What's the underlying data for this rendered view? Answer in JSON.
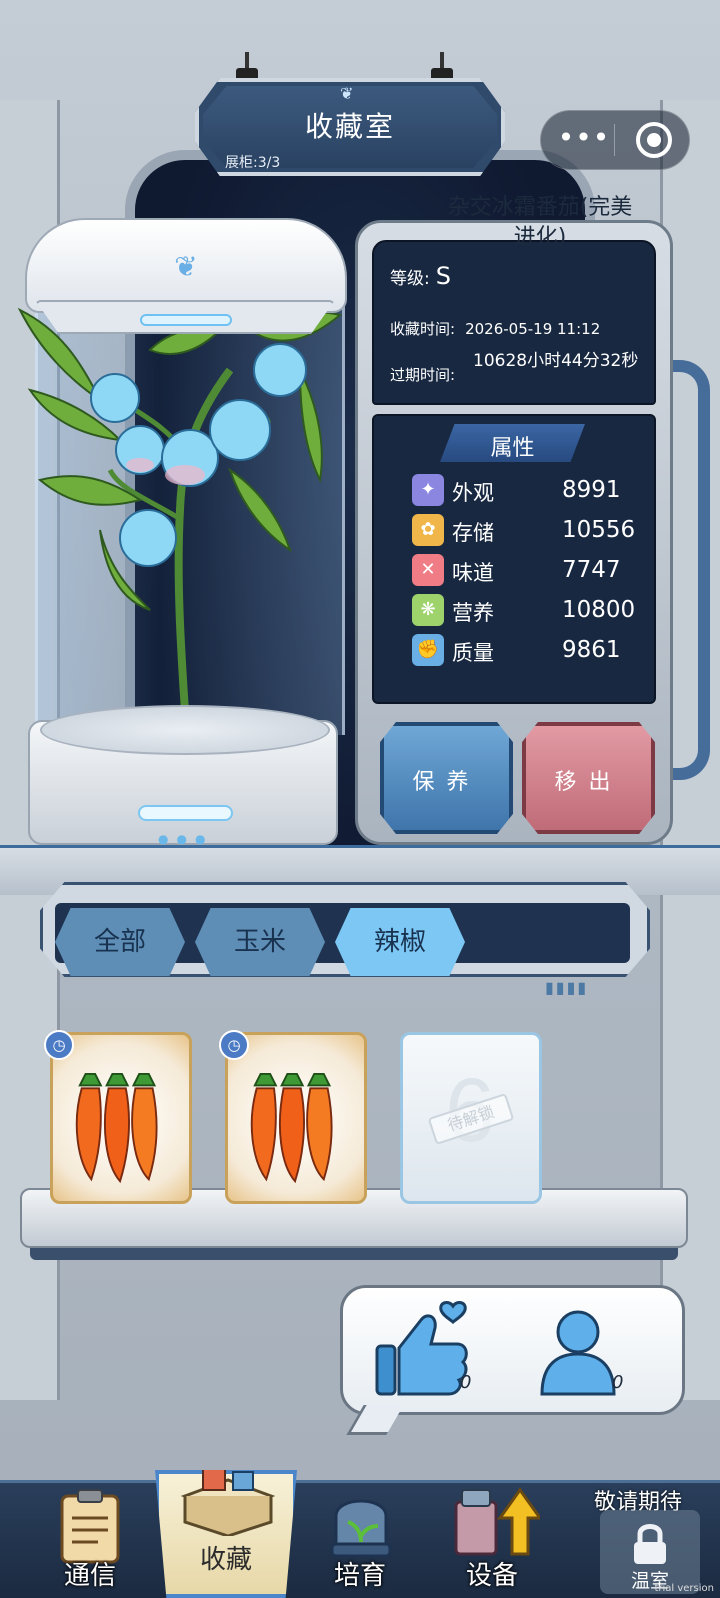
{
  "header": {
    "title": "收藏室",
    "cabinet_count": "展柜:3/3"
  },
  "capsule": {
    "more_icon": "more-dots-icon",
    "close_icon": "target-circle-icon"
  },
  "plant": {
    "name": "杂交冰霜番茄(完美进化)",
    "grade_label": "等级:",
    "grade_value": "S",
    "collect_time_label": "收藏时间:",
    "collect_time_value": "2026-05-19 11:12",
    "expire_label": "过期时间:",
    "expire_value": "10628小时44分32秒"
  },
  "attributes": {
    "title": "属性",
    "items": [
      {
        "label": "外观",
        "value": "8991",
        "icon": "sparkle-icon",
        "color": "#8b86e0"
      },
      {
        "label": "存储",
        "value": "10556",
        "icon": "wheat-icon",
        "color": "#f1b64a"
      },
      {
        "label": "味道",
        "value": "7747",
        "icon": "fork-spoon-icon",
        "color": "#f07d86"
      },
      {
        "label": "营养",
        "value": "10800",
        "icon": "nutrition-icon",
        "color": "#9ed36c"
      },
      {
        "label": "质量",
        "value": "9861",
        "icon": "muscle-icon",
        "color": "#6aaee6"
      }
    ]
  },
  "actions": {
    "keep": "保养",
    "remove": "移出"
  },
  "filters": {
    "tabs": [
      "全部",
      "玉米",
      "辣椒"
    ],
    "selected": "辣椒"
  },
  "shelf": {
    "locked_slot_text": "待解锁",
    "locked_slot_number": "6"
  },
  "social": {
    "likes": "0",
    "visits": "0"
  },
  "nav": {
    "items": [
      "通信",
      "收藏",
      "培育",
      "设备",
      "温室"
    ],
    "active": "收藏",
    "coming_soon": "敬请期待"
  },
  "watermark": "trial version"
}
